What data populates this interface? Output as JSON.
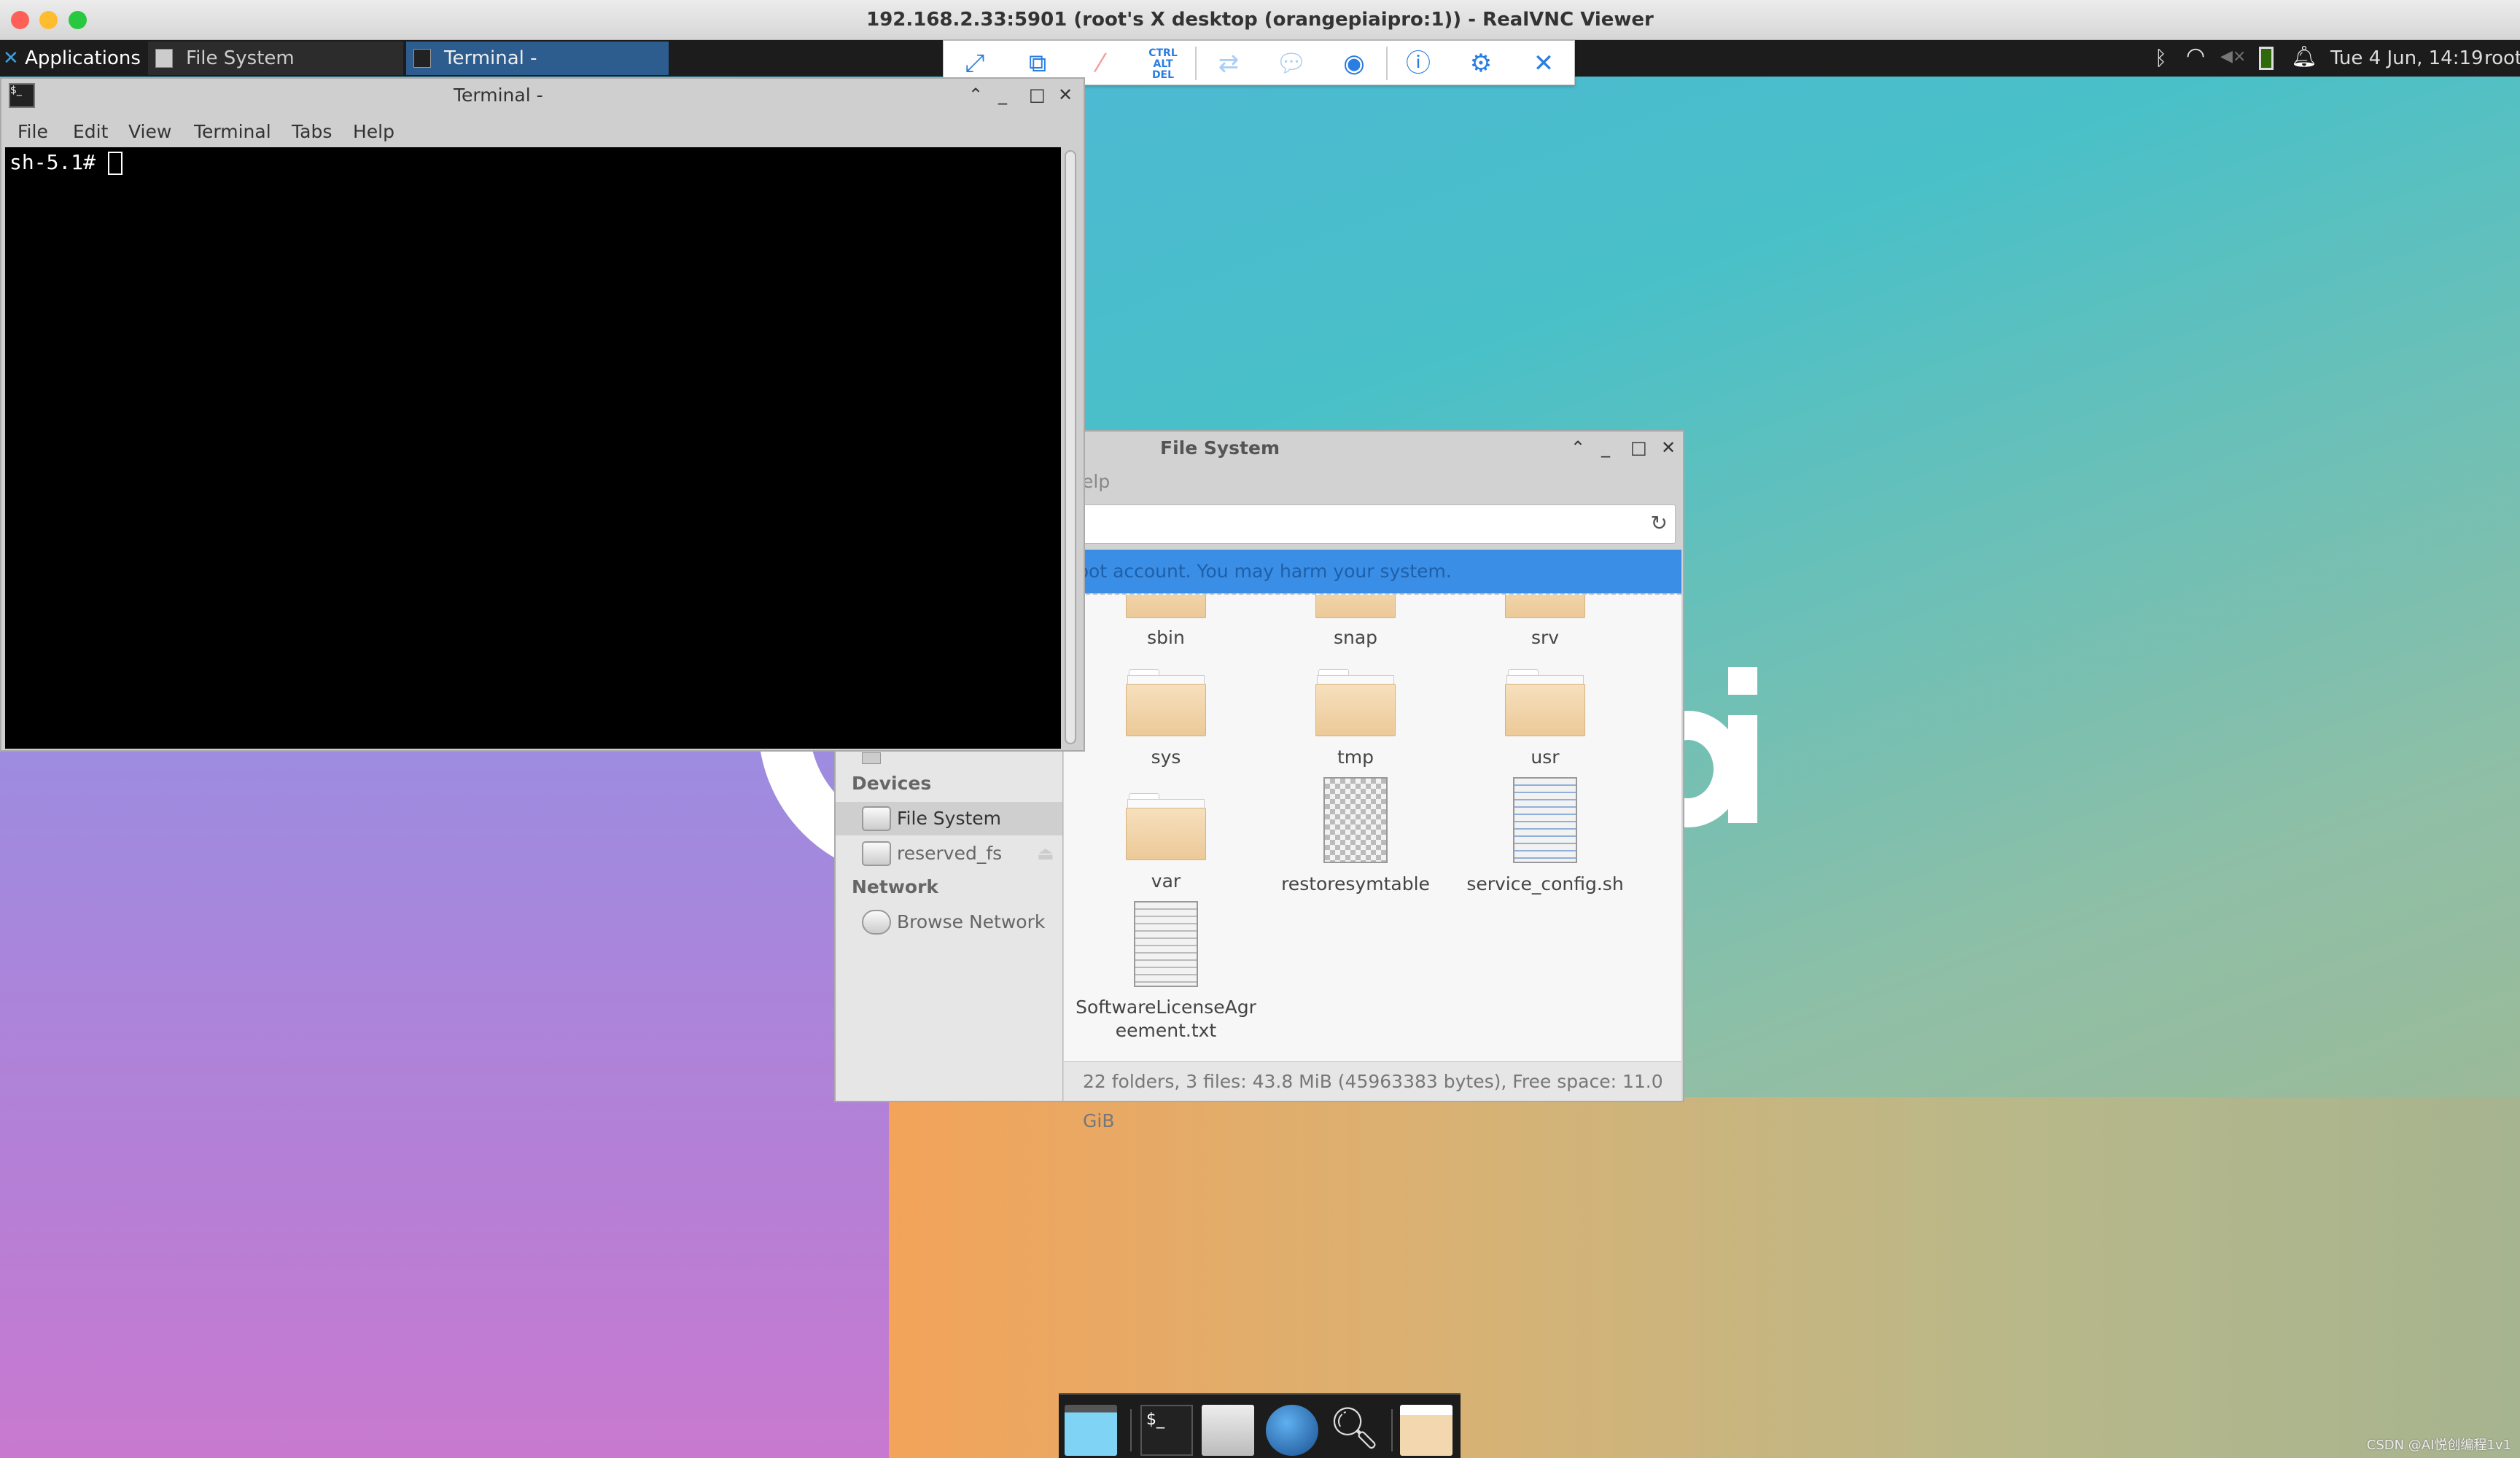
{
  "window_title": "192.168.2.33:5901 (root's X desktop (orangepiaipro:1)) - RealVNC Viewer",
  "panel": {
    "applications_label": "Applications",
    "tasks": [
      {
        "label": "File System",
        "active": false
      },
      {
        "label": "Terminal -",
        "active": true
      }
    ],
    "tray_icons": [
      "bluetooth-icon",
      "wifi-icon",
      "volume-muted-icon",
      "battery-icon",
      "notification-bell-icon"
    ],
    "clock": "Tue  4 Jun, 14:19",
    "user": "root"
  },
  "vnc_toolbar": {
    "buttons": [
      "fullscreen",
      "scale",
      "audio-muted",
      "ctrl-alt-del",
      "file-transfer",
      "chat",
      "record",
      "info",
      "settings",
      "close"
    ],
    "ctrl_alt_del_label": [
      "CTRL",
      "ALT",
      "DEL"
    ],
    "accent": "#2a7de1"
  },
  "terminal": {
    "title": "Terminal -",
    "menu": [
      "File",
      "Edit",
      "View",
      "Terminal",
      "Tabs",
      "Help"
    ],
    "prompt": "sh-5.1# "
  },
  "file_manager": {
    "title": "File System",
    "menu_partial": "elp",
    "warning": "root account. You may harm your system.",
    "warning_color": "#3a8ee6",
    "sidebar": {
      "devices_heading": "Devices",
      "devices": [
        {
          "label": "File System",
          "selected": true
        },
        {
          "label": "reserved_fs",
          "eject": true
        }
      ],
      "network_heading": "Network",
      "network": [
        {
          "label": "Browse Network"
        }
      ]
    },
    "items": [
      {
        "name": "sbin",
        "type": "folder-link"
      },
      {
        "name": "snap",
        "type": "folder"
      },
      {
        "name": "srv",
        "type": "folder"
      },
      {
        "name": "sys",
        "type": "folder"
      },
      {
        "name": "tmp",
        "type": "folder"
      },
      {
        "name": "usr",
        "type": "folder"
      },
      {
        "name": "var",
        "type": "folder"
      },
      {
        "name": "restoresymtable",
        "type": "binary"
      },
      {
        "name": "service_config.sh",
        "type": "script"
      },
      {
        "name": "SoftwareLicenseAgreement.txt",
        "display": [
          "SoftwareLicenseAgr",
          "eement.txt"
        ],
        "type": "text"
      }
    ],
    "status": "22 folders, 3 files: 43.8 MiB (45963383 bytes), Free space: 11.0 GiB"
  },
  "dock": [
    "show-desktop-icon",
    "terminal-icon",
    "home-folder-icon",
    "web-browser-icon",
    "search-icon",
    "folder-icon"
  ],
  "watermark": "CSDN @AI悦创编程1v1"
}
